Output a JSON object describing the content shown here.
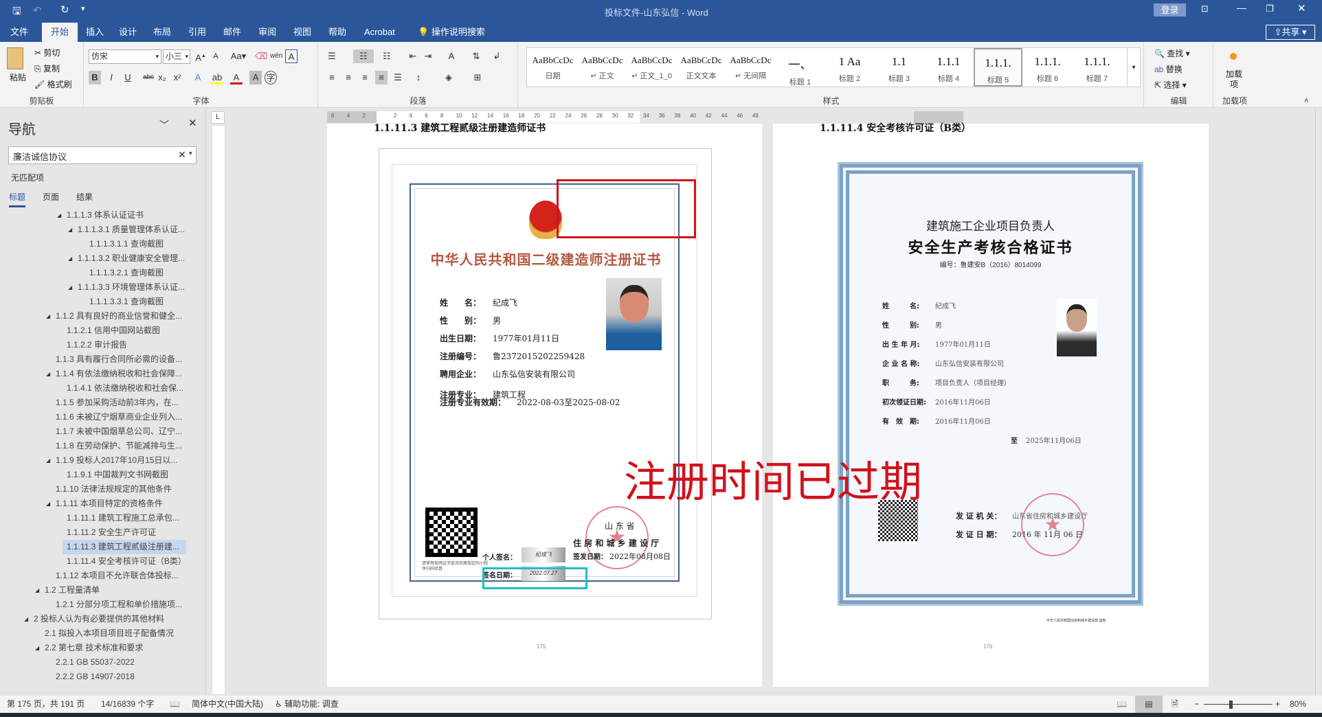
{
  "window": {
    "title": "投标文件-山东弘信  -  Word",
    "login": "登录",
    "share": "共享"
  },
  "tabs": [
    "文件",
    "开始",
    "插入",
    "设计",
    "布局",
    "引用",
    "邮件",
    "审阅",
    "视图",
    "帮助",
    "Acrobat"
  ],
  "tell_me": "操作说明搜索",
  "ribbon": {
    "clipboard": {
      "paste": "粘贴",
      "cut": "剪切",
      "copy": "复制",
      "format_painter": "格式刷",
      "label": "剪贴板"
    },
    "font": {
      "name": "仿宋",
      "size": "小三",
      "label": "字体"
    },
    "paragraph": {
      "label": "段落"
    },
    "styles": {
      "label": "样式",
      "items": [
        {
          "preview": "AaBbCcDc",
          "name": "日期"
        },
        {
          "preview": "AaBbCcDc",
          "name": "↵ 正文"
        },
        {
          "preview": "AaBbCcDc",
          "name": "↵ 正文_1_0"
        },
        {
          "preview": "AaBbCcDc",
          "name": "正文文本"
        },
        {
          "preview": "AaBbCcDc",
          "name": "↵ 无间隔"
        },
        {
          "preview": "一、",
          "name": "标题 1"
        },
        {
          "preview": "1  Aa",
          "name": "标题 2"
        },
        {
          "preview": "1.1",
          "name": "标题 3"
        },
        {
          "preview": "1.1.1",
          "name": "标题 4"
        },
        {
          "preview": "1.1.1.",
          "name": "标题 5"
        },
        {
          "preview": "1.1.1.",
          "name": "标题 6"
        },
        {
          "preview": "1.1.1.",
          "name": "标题 7"
        }
      ]
    },
    "editing": {
      "find": "查找",
      "replace": "替换",
      "select": "选择",
      "label": "编辑"
    },
    "addins": {
      "button": "加载项",
      "label": "加载项"
    }
  },
  "nav": {
    "title": "导航",
    "search": "廉洁诚信协议",
    "no_match": "无匹配项",
    "tabs": [
      "标题",
      "页面",
      "结果"
    ],
    "items": [
      {
        "t": "1.1.1.3 体系认证证书",
        "l": 3,
        "c": true
      },
      {
        "t": "1.1.1.3.1 质量管理体系认证...",
        "l": 4,
        "c": true
      },
      {
        "t": "1.1.1.3.1.1 查询截图",
        "l": 5
      },
      {
        "t": "1.1.1.3.2 职业健康安全管理...",
        "l": 4,
        "c": true
      },
      {
        "t": "1.1.1.3.2.1 查询截图",
        "l": 5
      },
      {
        "t": "1.1.1.3.3 环境管理体系认证...",
        "l": 4,
        "c": true
      },
      {
        "t": "1.1.1.3.3.1 查询截图",
        "l": 5
      },
      {
        "t": "1.1.2 具有良好的商业信誉和健全...",
        "l": 2,
        "c": true
      },
      {
        "t": "1.1.2.1 信用中国网站截图",
        "l": 3
      },
      {
        "t": "1.1.2.2 审计报告",
        "l": 3
      },
      {
        "t": "1.1.3 具有履行合同所必需的设备...",
        "l": 2
      },
      {
        "t": "1.1.4 有依法缴纳税收和社会保障...",
        "l": 2,
        "c": true
      },
      {
        "t": "1.1.4.1 依法缴纳税收和社会保...",
        "l": 3
      },
      {
        "t": "1.1.5 参加采购活动前3年内，在...",
        "l": 2
      },
      {
        "t": "1.1.6 未被辽宁烟草商业企业列入...",
        "l": 2
      },
      {
        "t": "1.1.7 未被中国烟草总公司、辽宁...",
        "l": 2
      },
      {
        "t": "1.1.8 在劳动保护、节能减排与生...",
        "l": 2
      },
      {
        "t": "1.1.9 投标人2017年10月15日以...",
        "l": 2,
        "c": true
      },
      {
        "t": "1.1.9.1 中国裁判文书网截图",
        "l": 3
      },
      {
        "t": "1.1.10 法律法规规定的其他条件",
        "l": 2
      },
      {
        "t": "1.1.11 本项目特定的资格条件",
        "l": 2,
        "c": true
      },
      {
        "t": "1.1.11.1 建筑工程施工总承包...",
        "l": 3
      },
      {
        "t": "1.1.11.2 安全生产许可证",
        "l": 3
      },
      {
        "t": "1.1.11.3 建筑工程贰级注册建...",
        "l": 3,
        "sel": true
      },
      {
        "t": "1.1.11.4 安全考核许可证（B类）",
        "l": 3
      },
      {
        "t": "1.1.12 本项目不允许联合体投标...",
        "l": 2
      },
      {
        "t": "1.2 工程量清单",
        "l": 1,
        "c": true
      },
      {
        "t": "1.2.1 分部分项工程和单价措施项...",
        "l": 2
      },
      {
        "t": "2 投标人认为有必要提供的其他材料",
        "l": 0,
        "c": true
      },
      {
        "t": "2.1 拟投入本项目项目班子配备情况",
        "l": 1
      },
      {
        "t": "2.2 第七章 技术标准和要求",
        "l": 1,
        "c": true
      },
      {
        "t": "2.2.1 GB 55037-2022",
        "l": 2
      },
      {
        "t": "2.2.2 GB 14907-2018",
        "l": 2
      }
    ]
  },
  "ruler": {
    "ticks": [
      "6",
      "4",
      "2",
      "",
      "2",
      "4",
      "6",
      "8",
      "10",
      "12",
      "14",
      "16",
      "18",
      "20",
      "22",
      "24",
      "26",
      "28",
      "30",
      "32",
      "34",
      "36",
      "38",
      "40",
      "42",
      "44",
      "46",
      "48"
    ]
  },
  "page1": {
    "heading": "1.1.11.3 建筑工程贰级注册建造师证书",
    "cert": {
      "title": "中华人民共和国二级建造师注册证书",
      "fields": [
        [
          "姓　　名：",
          "纪成飞"
        ],
        [
          "性　　别：",
          "男"
        ],
        [
          "出生日期：",
          "1977年01月11日"
        ],
        [
          "注册编号：",
          "鲁2372015202259428"
        ],
        [
          "聘用企业：",
          "山东弘信安装有限公司"
        ],
        [
          "注册专业：",
          "建筑工程"
        ]
      ],
      "validity_label": "注册专业有效期：",
      "validity": "2022-08-03至2025-08-02",
      "qr_note": "请使用官网证书查询页面指定的小程序扫码验真",
      "sign_label": "个人签名：",
      "sign_date_label": "签名日期：",
      "sign_date": "2022.07.27",
      "issuer_province": "山 东 省",
      "issuer": "住 房 和 城 乡 建 设 厅",
      "issue_label": "签发日期：",
      "issue_date": "2022年08月08日"
    },
    "page_no": "175"
  },
  "page2": {
    "heading": "1.1.11.4 安全考核许可证（B类）",
    "cert": {
      "subtitle": "建筑施工企业项目负责人",
      "title": "安全生产考核合格证书",
      "number": "编号：鲁建安B（2016）8014099",
      "fields": [
        [
          "姓　　　名:",
          "纪成飞"
        ],
        [
          "性　　　别:",
          "男"
        ],
        [
          "出 生 年 月:",
          "1977年01月11日"
        ],
        [
          "企 业 名 称:",
          "山东弘信安装有限公司"
        ],
        [
          "职　　　务:",
          "项目负责人（项目经理）"
        ],
        [
          "初次领证日期:",
          "2016年11月06日"
        ],
        [
          "有　效　期:",
          "2016年11月06日"
        ]
      ],
      "to_label": "至",
      "to_date": "2025年11月06日",
      "authority_label": "发 证 机 关：",
      "authority": "山东省住房和城乡建设厅",
      "date_label": "发 证 日 期：",
      "date": "2016 年 11月 06 日",
      "footer": "中华人民共和国住房和城乡建设部 监制"
    },
    "page_no": "176"
  },
  "annotation": {
    "text": "注册时间已过期",
    "color": "#d0121b"
  },
  "status": {
    "page": "第 175 页，共 191 页",
    "words": "14/16839 个字",
    "lang": "简体中文(中国大陆)",
    "accessibility": "辅助功能: 调查",
    "zoom": "80%"
  },
  "colors": {
    "brand": "#2b579a"
  }
}
